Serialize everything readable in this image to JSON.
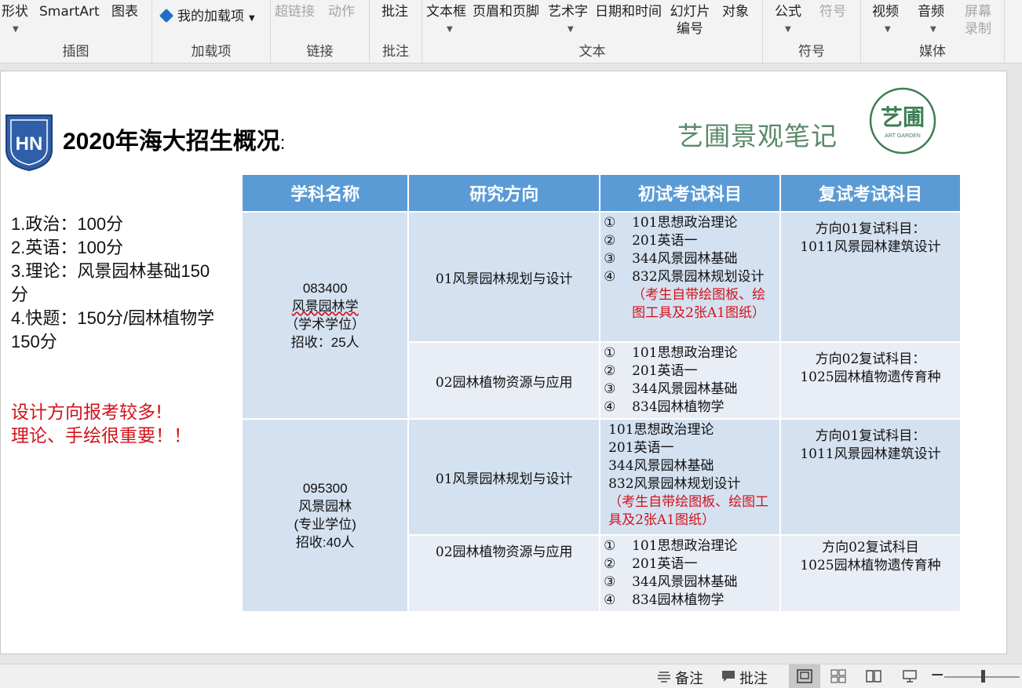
{
  "ribbon": {
    "groups": [
      {
        "label": "插图",
        "buttons": [
          "形状",
          "SmartArt",
          "图表"
        ]
      },
      {
        "label": "加载项",
        "buttons": [
          "我的加载项"
        ]
      },
      {
        "label": "链接",
        "buttons": [
          "超链接",
          "动作"
        ]
      },
      {
        "label": "批注",
        "buttons": [
          "批注"
        ]
      },
      {
        "label": "文本",
        "buttons": [
          "文本框",
          "页眉和页脚",
          "艺术字",
          "日期和时间",
          "幻灯片编号",
          "对象"
        ]
      },
      {
        "label": "符号",
        "buttons": [
          "公式",
          "符号"
        ]
      },
      {
        "label": "媒体",
        "buttons": [
          "视频",
          "音频",
          "屏幕录制"
        ]
      }
    ]
  },
  "slide": {
    "title": "2020年海大招生概况",
    "title_suffix": ":",
    "brand": "艺圃景观笔记",
    "seal_text": "艺圃",
    "seal_sub": "ART GARDEN",
    "logo_text": "HN",
    "notes": [
      "1.政治：100分",
      "2.英语：100分",
      "3.理论：风景园林基础150分",
      "4.快题：150分/园林植物学150分"
    ],
    "emphasis": [
      "设计方向报考较多!",
      "理论、手绘很重要！！"
    ],
    "table": {
      "headers": [
        "学科名称",
        "研究方向",
        "初试考试科目",
        "复试考试科目"
      ],
      "subjects": [
        {
          "code": "083400",
          "name": "风景园林学",
          "type": "（学术学位）",
          "quota": "招收：25人"
        },
        {
          "code": "095300",
          "name": "风景园林",
          "type": "(专业学位)",
          "quota": "招收:40人"
        }
      ],
      "rows": [
        {
          "direction": "01风景园林规划与设计",
          "exams": [
            [
              "①",
              "101思想政治理论"
            ],
            [
              "②",
              "201英语一"
            ],
            [
              "③",
              "344风景园林基础"
            ],
            [
              "④",
              "832风景园林规划设计"
            ]
          ],
          "exam_note": "（考生自带绘图板、绘图工具及2张A1图纸）",
          "retest_title": "方向01复试科目：",
          "retest_subject": "1011风景园林建筑设计"
        },
        {
          "direction": "02园林植物资源与应用",
          "exams": [
            [
              "①",
              "101思想政治理论"
            ],
            [
              "②",
              "201英语一"
            ],
            [
              "③",
              "344风景园林基础"
            ],
            [
              "④",
              "834园林植物学"
            ]
          ],
          "retest_title": "方向02复试科目：",
          "retest_subject": "1025园林植物遗传育种"
        },
        {
          "direction": "01风景园林规划与设计",
          "exams": [
            [
              "",
              "101思想政治理论"
            ],
            [
              "",
              "201英语一"
            ],
            [
              "",
              "344风景园林基础"
            ],
            [
              "",
              "832风景园林规划设计"
            ]
          ],
          "exam_note": "（考生自带绘图板、绘图工具及2张A1图纸）",
          "retest_title": "方向01复试科目：",
          "retest_subject": "1011风景园林建筑设计"
        },
        {
          "direction": "02园林植物资源与应用",
          "exams": [
            [
              "①",
              "101思想政治理论"
            ],
            [
              "②",
              "201英语一"
            ],
            [
              "③",
              "344风景园林基础"
            ],
            [
              "④",
              "834园林植物学"
            ]
          ],
          "retest_title": "方向02复试科目",
          "retest_subject": "1025园林植物遗传育种"
        }
      ]
    }
  },
  "statusbar": {
    "notes_label": "备注",
    "comments_label": "批注"
  },
  "colors": {
    "header": "#5b9bd5",
    "cell_dark": "#d4e1f0",
    "cell_light": "#e9eef6",
    "red": "#d2121b",
    "brand": "#5a8a6a"
  }
}
